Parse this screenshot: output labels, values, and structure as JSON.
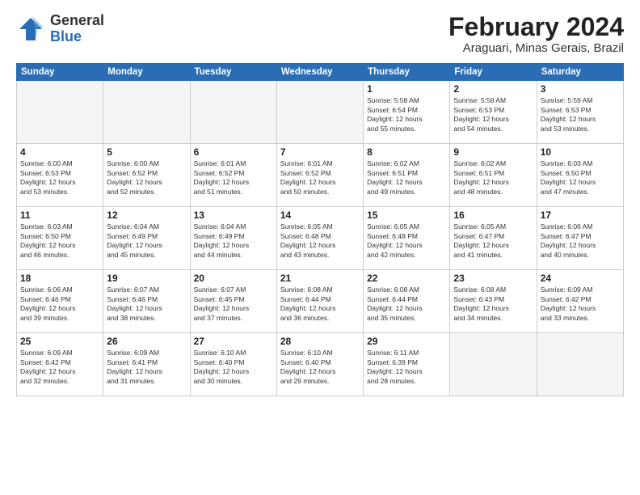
{
  "logo": {
    "general": "General",
    "blue": "Blue"
  },
  "title": {
    "month_year": "February 2024",
    "location": "Araguari, Minas Gerais, Brazil"
  },
  "weekdays": [
    "Sunday",
    "Monday",
    "Tuesday",
    "Wednesday",
    "Thursday",
    "Friday",
    "Saturday"
  ],
  "weeks": [
    [
      {
        "day": "",
        "info": ""
      },
      {
        "day": "",
        "info": ""
      },
      {
        "day": "",
        "info": ""
      },
      {
        "day": "",
        "info": ""
      },
      {
        "day": "1",
        "info": "Sunrise: 5:58 AM\nSunset: 6:54 PM\nDaylight: 12 hours\nand 55 minutes."
      },
      {
        "day": "2",
        "info": "Sunrise: 5:58 AM\nSunset: 6:53 PM\nDaylight: 12 hours\nand 54 minutes."
      },
      {
        "day": "3",
        "info": "Sunrise: 5:59 AM\nSunset: 6:53 PM\nDaylight: 12 hours\nand 53 minutes."
      }
    ],
    [
      {
        "day": "4",
        "info": "Sunrise: 6:00 AM\nSunset: 6:53 PM\nDaylight: 12 hours\nand 53 minutes."
      },
      {
        "day": "5",
        "info": "Sunrise: 6:00 AM\nSunset: 6:52 PM\nDaylight: 12 hours\nand 52 minutes."
      },
      {
        "day": "6",
        "info": "Sunrise: 6:01 AM\nSunset: 6:52 PM\nDaylight: 12 hours\nand 51 minutes."
      },
      {
        "day": "7",
        "info": "Sunrise: 6:01 AM\nSunset: 6:52 PM\nDaylight: 12 hours\nand 50 minutes."
      },
      {
        "day": "8",
        "info": "Sunrise: 6:02 AM\nSunset: 6:51 PM\nDaylight: 12 hours\nand 49 minutes."
      },
      {
        "day": "9",
        "info": "Sunrise: 6:02 AM\nSunset: 6:51 PM\nDaylight: 12 hours\nand 48 minutes."
      },
      {
        "day": "10",
        "info": "Sunrise: 6:03 AM\nSunset: 6:50 PM\nDaylight: 12 hours\nand 47 minutes."
      }
    ],
    [
      {
        "day": "11",
        "info": "Sunrise: 6:03 AM\nSunset: 6:50 PM\nDaylight: 12 hours\nand 46 minutes."
      },
      {
        "day": "12",
        "info": "Sunrise: 6:04 AM\nSunset: 6:49 PM\nDaylight: 12 hours\nand 45 minutes."
      },
      {
        "day": "13",
        "info": "Sunrise: 6:04 AM\nSunset: 6:49 PM\nDaylight: 12 hours\nand 44 minutes."
      },
      {
        "day": "14",
        "info": "Sunrise: 6:05 AM\nSunset: 6:48 PM\nDaylight: 12 hours\nand 43 minutes."
      },
      {
        "day": "15",
        "info": "Sunrise: 6:05 AM\nSunset: 6:48 PM\nDaylight: 12 hours\nand 42 minutes."
      },
      {
        "day": "16",
        "info": "Sunrise: 6:05 AM\nSunset: 6:47 PM\nDaylight: 12 hours\nand 41 minutes."
      },
      {
        "day": "17",
        "info": "Sunrise: 6:06 AM\nSunset: 6:47 PM\nDaylight: 12 hours\nand 40 minutes."
      }
    ],
    [
      {
        "day": "18",
        "info": "Sunrise: 6:06 AM\nSunset: 6:46 PM\nDaylight: 12 hours\nand 39 minutes."
      },
      {
        "day": "19",
        "info": "Sunrise: 6:07 AM\nSunset: 6:46 PM\nDaylight: 12 hours\nand 38 minutes."
      },
      {
        "day": "20",
        "info": "Sunrise: 6:07 AM\nSunset: 6:45 PM\nDaylight: 12 hours\nand 37 minutes."
      },
      {
        "day": "21",
        "info": "Sunrise: 6:08 AM\nSunset: 6:44 PM\nDaylight: 12 hours\nand 36 minutes."
      },
      {
        "day": "22",
        "info": "Sunrise: 6:08 AM\nSunset: 6:44 PM\nDaylight: 12 hours\nand 35 minutes."
      },
      {
        "day": "23",
        "info": "Sunrise: 6:08 AM\nSunset: 6:43 PM\nDaylight: 12 hours\nand 34 minutes."
      },
      {
        "day": "24",
        "info": "Sunrise: 6:09 AM\nSunset: 6:42 PM\nDaylight: 12 hours\nand 33 minutes."
      }
    ],
    [
      {
        "day": "25",
        "info": "Sunrise: 6:09 AM\nSunset: 6:42 PM\nDaylight: 12 hours\nand 32 minutes."
      },
      {
        "day": "26",
        "info": "Sunrise: 6:09 AM\nSunset: 6:41 PM\nDaylight: 12 hours\nand 31 minutes."
      },
      {
        "day": "27",
        "info": "Sunrise: 6:10 AM\nSunset: 6:40 PM\nDaylight: 12 hours\nand 30 minutes."
      },
      {
        "day": "28",
        "info": "Sunrise: 6:10 AM\nSunset: 6:40 PM\nDaylight: 12 hours\nand 29 minutes."
      },
      {
        "day": "29",
        "info": "Sunrise: 6:11 AM\nSunset: 6:39 PM\nDaylight: 12 hours\nand 28 minutes."
      },
      {
        "day": "",
        "info": ""
      },
      {
        "day": "",
        "info": ""
      }
    ]
  ]
}
